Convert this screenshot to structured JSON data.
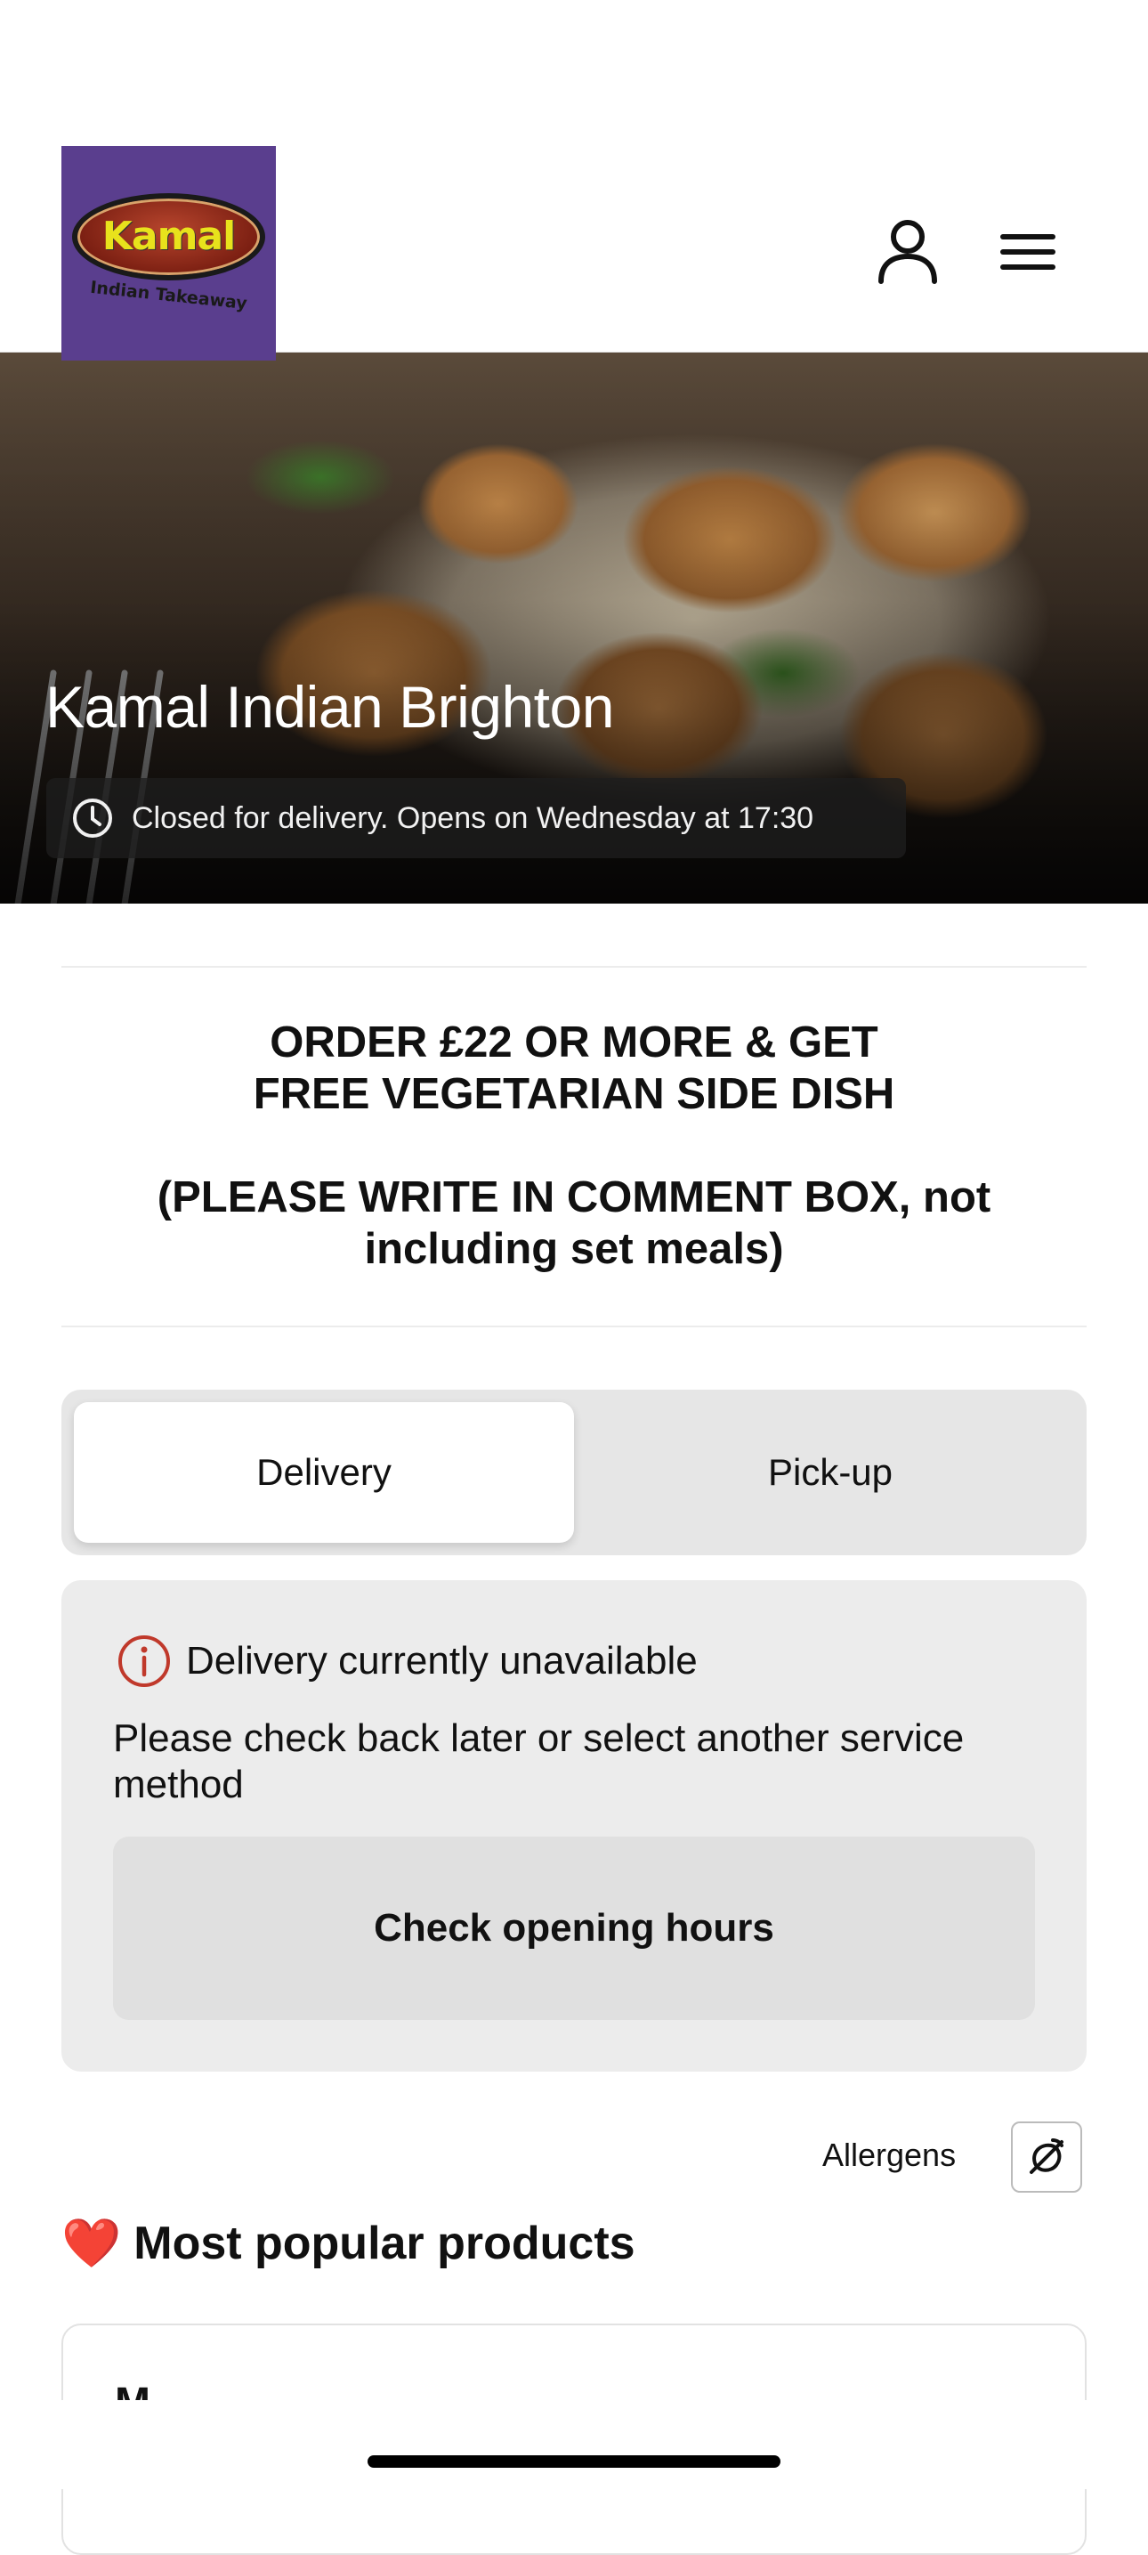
{
  "header": {
    "logo": {
      "name": "Kamal",
      "subtitle": "Indian Takeaway",
      "bg_color": "#5a3e8e"
    },
    "account_icon": "user-icon",
    "menu_icon": "hamburger-menu-icon"
  },
  "hero": {
    "restaurant_name": "Kamal Indian Brighton",
    "status_icon": "clock-icon",
    "status_text": "Closed for delivery. Opens on Wednesday at 17:30"
  },
  "promo": {
    "line1": "ORDER £22 OR MORE & GET FREE VEGETARIAN SIDE DISH",
    "line2": "(PLEASE WRITE IN COMMENT BOX, not including set meals)"
  },
  "service_toggle": {
    "options": [
      "Delivery",
      "Pick-up"
    ],
    "selected": "Delivery"
  },
  "delivery_notice": {
    "icon": "info-icon",
    "icon_color": "#c0392b",
    "title": "Delivery currently unavailable",
    "message": "Please check back later or select another service method",
    "button_label": "Check opening hours"
  },
  "allergens": {
    "label": "Allergens",
    "icon": "allergen-icon"
  },
  "popular": {
    "emoji": "❤️",
    "title": "Most popular products",
    "first_item_partial": "M..."
  }
}
